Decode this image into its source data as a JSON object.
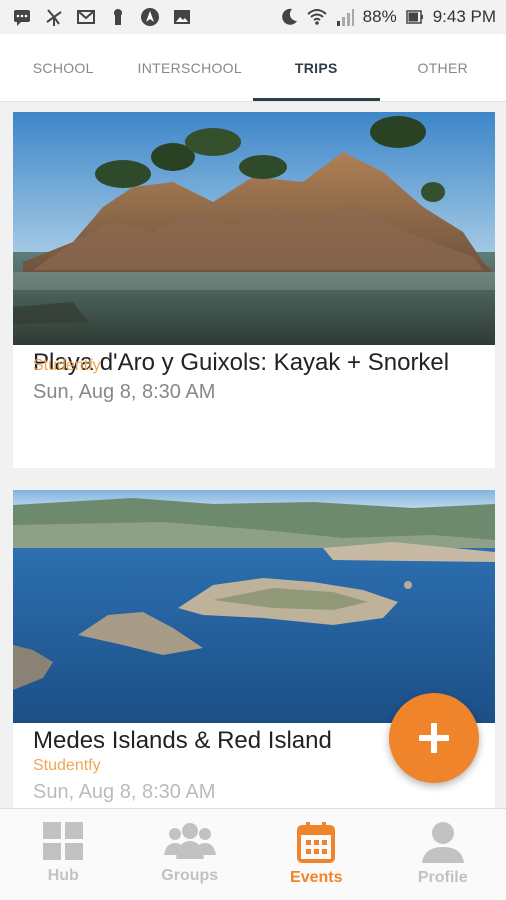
{
  "status_bar": {
    "battery": "88%",
    "time": "9:43 PM",
    "left_icons": [
      "message-icon",
      "pinwheel-icon",
      "gmail-icon",
      "keyhole-icon",
      "navigation-icon",
      "image-icon"
    ],
    "right_icons": [
      "moon-icon",
      "wifi-icon",
      "signal-icon",
      "battery-icon"
    ]
  },
  "tabs": [
    {
      "label": "SCHOOL",
      "active": false
    },
    {
      "label": "INTERSCHOOL",
      "active": false
    },
    {
      "label": "TRIPS",
      "active": true
    },
    {
      "label": "OTHER",
      "active": false
    }
  ],
  "events": [
    {
      "title": "Playa d'Aro y Guixols: Kayak + Snorkel",
      "organizer": "Studentfy",
      "date": "Sun, Aug 8, 8:30 AM",
      "image": "rocky-island-photo"
    },
    {
      "title": "Medes Islands & Red Island",
      "organizer": "Studentfy",
      "date": "Sun, Aug 8, 8:30 AM",
      "image": "medes-islands-aerial-photo"
    }
  ],
  "fab": {
    "icon": "plus-icon"
  },
  "bottom_nav": [
    {
      "label": "Hub",
      "icon": "grid-icon",
      "active": false
    },
    {
      "label": "Groups",
      "icon": "people-icon",
      "active": false
    },
    {
      "label": "Events",
      "icon": "calendar-icon",
      "active": true
    },
    {
      "label": "Profile",
      "icon": "person-icon",
      "active": false
    }
  ],
  "colors": {
    "accent": "#f0842b",
    "organizer": "#f0a552",
    "tab_active": "#2f3d47"
  }
}
